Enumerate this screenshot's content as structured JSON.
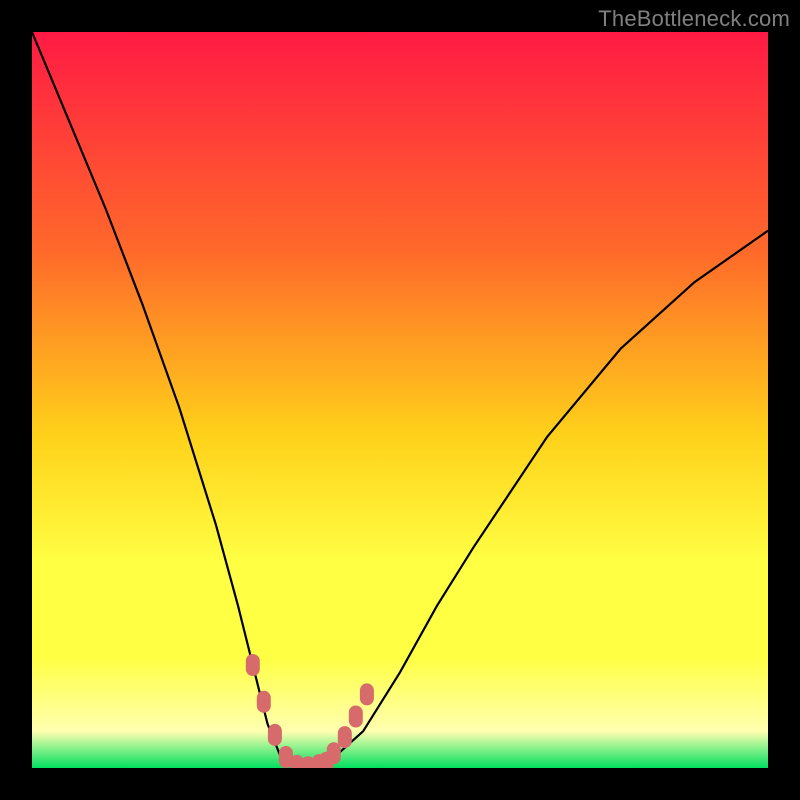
{
  "watermark": "TheBottleneck.com",
  "colors": {
    "frame": "#000000",
    "grad_top": "#ff1a44",
    "grad_mid1": "#ff6a2a",
    "grad_mid2": "#ffd21a",
    "grad_mid3": "#ffff44",
    "grad_pale": "#ffffb0",
    "grad_bottom": "#00e060",
    "curve": "#000000",
    "marker": "#d76a6a"
  },
  "chart_data": {
    "type": "line",
    "title": "",
    "xlabel": "",
    "ylabel": "",
    "xlim": [
      0,
      100
    ],
    "ylim": [
      0,
      100
    ],
    "series": [
      {
        "name": "bottleneck-curve",
        "x": [
          0,
          5,
          10,
          15,
          20,
          25,
          28,
          30,
          32,
          34,
          36,
          38,
          40,
          45,
          50,
          55,
          60,
          70,
          80,
          90,
          100
        ],
        "y": [
          100,
          88,
          76,
          63,
          49,
          33,
          22,
          14,
          6,
          1,
          0,
          0,
          0.5,
          5,
          13,
          22,
          30,
          45,
          57,
          66,
          73
        ]
      }
    ],
    "markers": {
      "name": "highlight-points",
      "x": [
        30,
        31.5,
        33,
        34.5,
        36,
        37.5,
        39,
        40,
        41,
        42.5,
        44,
        45.5
      ],
      "y": [
        14,
        9,
        4.5,
        1.5,
        0.3,
        0.1,
        0.4,
        0.7,
        2,
        4.2,
        7,
        10
      ]
    }
  }
}
